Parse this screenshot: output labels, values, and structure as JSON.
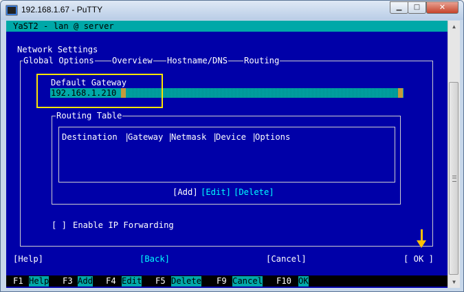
{
  "window": {
    "title": "192.168.1.67 - PuTTY",
    "minimize": "▁",
    "maximize": "□",
    "close": "✕"
  },
  "header": {
    "title": "YaST2 - lan @ server"
  },
  "section_title": "Network Settings",
  "tabs": [
    "Global Options",
    "Overview",
    "Hostname/DNS",
    "Routing"
  ],
  "gateway": {
    "label": "Default Gateway",
    "value": "192.168.1.210"
  },
  "routing_table": {
    "title": "Routing Table",
    "columns": [
      "Destination",
      "Gateway",
      "Netmask",
      "Device",
      "Options"
    ],
    "rows": [],
    "add_label": "[Add]",
    "edit_label": "[Edit]",
    "delete_label": "[Delete]"
  },
  "ip_forwarding": {
    "checkbox": "[ ]",
    "label": "Enable IP Forwarding"
  },
  "buttons": {
    "help": "[Help]",
    "back": "[Back]",
    "cancel": "[Cancel]",
    "ok": "[ OK ]"
  },
  "function_keys": [
    {
      "key": "F1",
      "label": "Help"
    },
    {
      "key": "F3",
      "label": "Add"
    },
    {
      "key": "F4",
      "label": "Edit"
    },
    {
      "key": "F5",
      "label": "Delete"
    },
    {
      "key": "F9",
      "label": "Cancel"
    },
    {
      "key": "F10",
      "label": "OK"
    }
  ],
  "scrollbar": {
    "up": "▲",
    "down": "▼"
  },
  "colors": {
    "terminal_bg": "#0000a8",
    "accent": "#00a8a8",
    "highlight": "#ffe600",
    "arrow": "#ffc000"
  }
}
